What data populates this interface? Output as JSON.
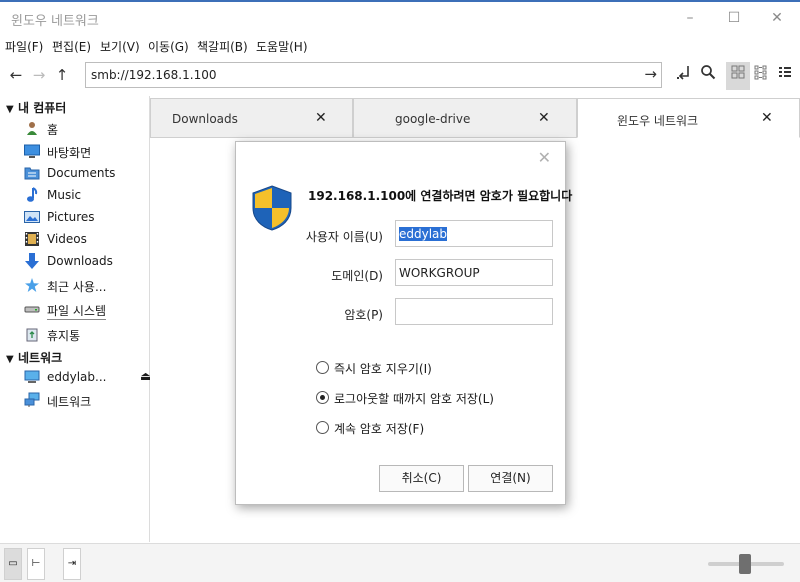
{
  "window": {
    "title": "윈도우 네트워크",
    "controls": {
      "minimize": "–",
      "maximize": "☐",
      "close": "✕"
    }
  },
  "menu": [
    "파일(F)",
    "편집(E)",
    "보기(V)",
    "이동(G)",
    "책갈피(B)",
    "도움말(H)"
  ],
  "toolbar": {
    "back_icon": "←",
    "forward_icon": "→",
    "up_icon": "↑",
    "address": "smb://192.168.1.100",
    "go_icon": "→"
  },
  "sidebar": {
    "computer_section": "내 컴퓨터",
    "computer_items": [
      {
        "label": "홈",
        "icon": "home-icon"
      },
      {
        "label": "바탕화면",
        "icon": "desktop-icon"
      },
      {
        "label": "Documents",
        "icon": "documents-icon"
      },
      {
        "label": "Music",
        "icon": "music-icon"
      },
      {
        "label": "Pictures",
        "icon": "pictures-icon"
      },
      {
        "label": "Videos",
        "icon": "videos-icon"
      },
      {
        "label": "Downloads",
        "icon": "downloads-icon"
      },
      {
        "label": "최근 사용...",
        "icon": "recent-icon"
      },
      {
        "label": "파일 시스템",
        "icon": "filesystem-icon"
      },
      {
        "label": "휴지통",
        "icon": "trash-icon"
      }
    ],
    "network_section": "네트워크",
    "network_items": [
      {
        "label": "eddylab...",
        "icon": "network-drive-icon"
      },
      {
        "label": "네트워크",
        "icon": "network-icon"
      }
    ]
  },
  "tabs": [
    {
      "label": "Downloads",
      "close": "✕"
    },
    {
      "label": "google-drive",
      "close": "✕"
    },
    {
      "label": "윈도우 네트워크",
      "close": "✕"
    }
  ],
  "dialog": {
    "close": "✕",
    "message": "192.168.1.100에 연결하려면 암호가 필요합니다",
    "username_label": "사용자 이름(U)",
    "username_value": "eddylab",
    "domain_label": "도메인(D)",
    "domain_value": "WORKGROUP",
    "password_label": "암호(P)",
    "password_value": "",
    "options": [
      {
        "label": "즉시 암호 지우기(I)",
        "selected": false
      },
      {
        "label": "로그아웃할 때까지 암호 저장(L)",
        "selected": true
      },
      {
        "label": "계속 암호 저장(F)",
        "selected": false
      }
    ],
    "cancel_label": "취소(C)",
    "connect_label": "연결(N)"
  },
  "colors": {
    "accent": "#2a6fd4",
    "shield_blue": "#1e63b8",
    "shield_yellow": "#f5c02a"
  }
}
